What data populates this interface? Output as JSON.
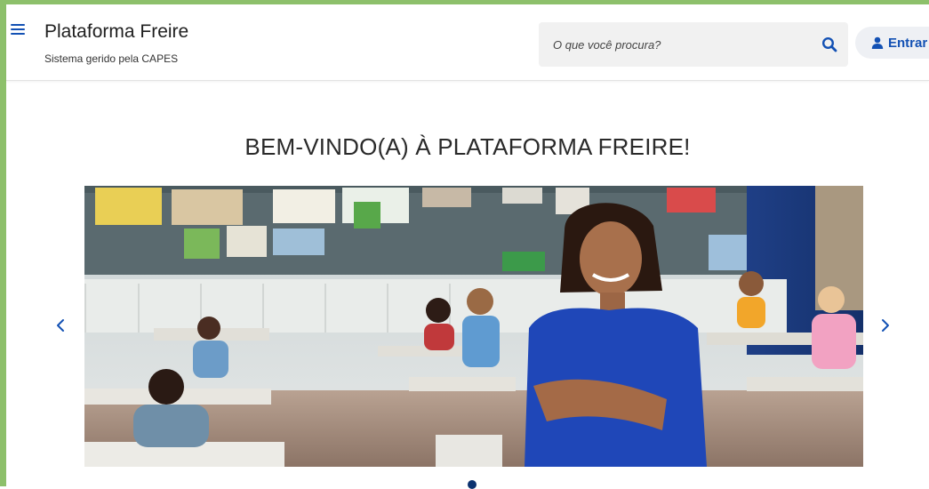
{
  "header": {
    "title": "Plataforma Freire",
    "subtitle": "Sistema gerido pela CAPES",
    "menu_icon": "menu-icon",
    "search": {
      "placeholder": "O que você procura?",
      "icon": "search-icon"
    },
    "login": {
      "label": "Entrar",
      "icon": "user-icon"
    }
  },
  "main": {
    "heading": "BEM-VINDO(A) À PLATAFORMA FREIRE!",
    "carousel": {
      "image_desc": "",
      "prev_icon": "chevron-left-icon",
      "next_icon": "chevron-right-icon"
    }
  },
  "colors": {
    "accent": "#1351b4",
    "frame": "#8dc06b",
    "dark_blue": "#0c326f"
  }
}
